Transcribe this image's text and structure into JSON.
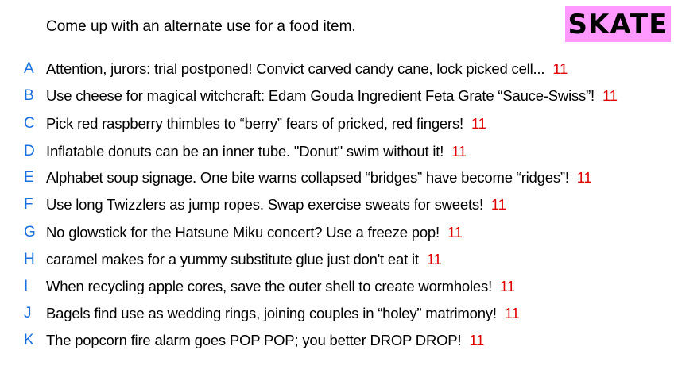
{
  "prompt": "Come up with an alternate use for a food item.",
  "badge": {
    "label": "SKATE",
    "color": "#ff99ff"
  },
  "colors": {
    "letter": "#1a6fe0",
    "score": "#e00000",
    "text": "#000000"
  },
  "answers": [
    {
      "letter": "A",
      "text": "Attention, jurors: trial postponed! Convict carved candy cane, lock picked cell...",
      "score": "11"
    },
    {
      "letter": "B",
      "text": "Use cheese for magical witchcraft: Edam Gouda Ingredient Feta Grate “Sauce-Swiss”!",
      "score": "11"
    },
    {
      "letter": "C",
      "text": "Pick red raspberry thimbles to “berry” fears of pricked, red fingers!",
      "score": "11"
    },
    {
      "letter": "D",
      "text": "Inflatable donuts can be an inner tube. \"Donut\" swim without it!",
      "score": "11"
    },
    {
      "letter": "E",
      "text": "Alphabet soup signage. One bite warns collapsed “bridges” have become “ridges”!",
      "score": "11"
    },
    {
      "letter": "F",
      "text": "Use long Twizzlers as jump ropes. Swap exercise sweats for sweets!",
      "score": "11"
    },
    {
      "letter": "G",
      "text": "No glowstick for the Hatsune Miku concert? Use a freeze pop!",
      "score": "11"
    },
    {
      "letter": "H",
      "text": "caramel makes for a yummy substitute glue just don't eat it",
      "score": "11"
    },
    {
      "letter": "I",
      "text": "When recycling apple cores, save the outer shell to create wormholes!",
      "score": "11"
    },
    {
      "letter": "J",
      "text": "Bagels find use as wedding rings, joining couples in “holey” matrimony!",
      "score": "11"
    },
    {
      "letter": "K",
      "text": "The popcorn fire alarm goes POP POP; you better DROP DROP!",
      "score": "11"
    }
  ]
}
